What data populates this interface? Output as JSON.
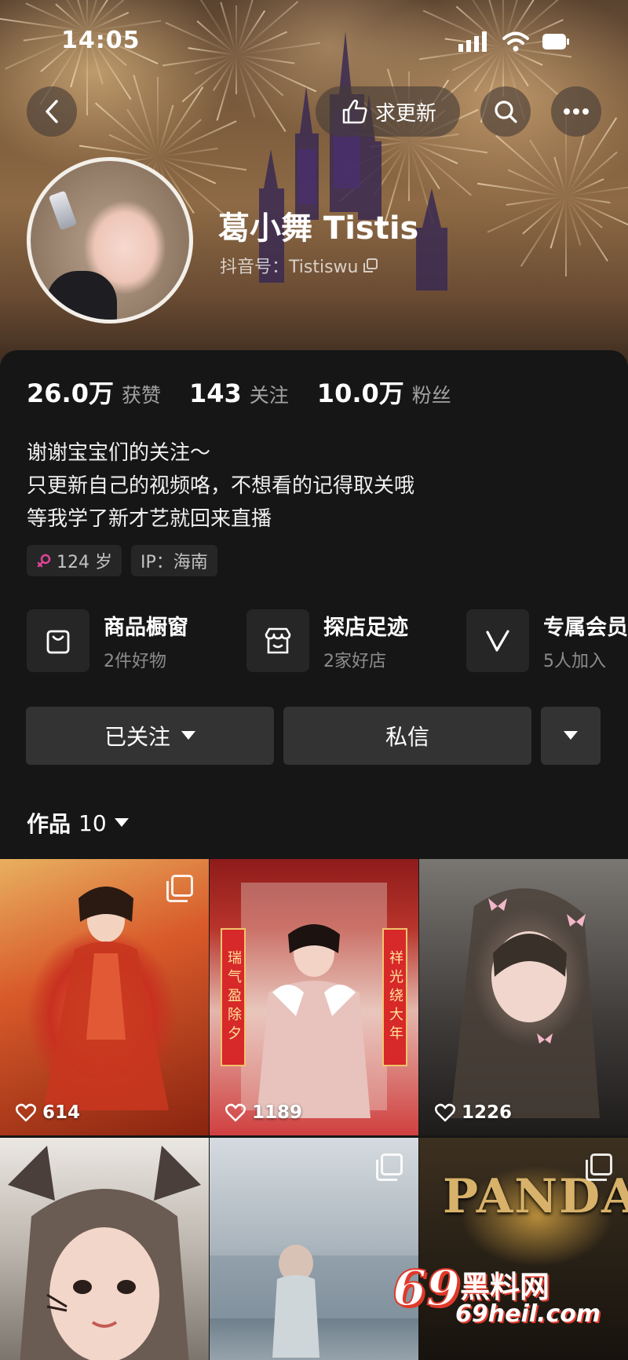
{
  "status_bar": {
    "time": "14:05"
  },
  "nav": {
    "request_update_label": "求更新"
  },
  "profile": {
    "name": "葛小舞 Tistis",
    "douyin_id": "抖音号：Tistiswu"
  },
  "stats": [
    {
      "value": "26.0万",
      "label": "获赞"
    },
    {
      "value": "143",
      "label": "关注"
    },
    {
      "value": "10.0万",
      "label": "粉丝"
    }
  ],
  "bio": [
    "谢谢宝宝们的关注～",
    "只更新自己的视频咯，不想看的记得取关哦",
    "等我学了新才艺就回来直播"
  ],
  "tags": {
    "age": "124 岁",
    "ip": "IP：海南"
  },
  "features": [
    {
      "title": "商品橱窗",
      "sub": "2件好物",
      "icon": "shopping-bag-icon"
    },
    {
      "title": "探店足迹",
      "sub": "2家好店",
      "icon": "store-icon"
    },
    {
      "title": "专属会员",
      "sub": "5人加入",
      "icon": "vip-icon"
    }
  ],
  "actions": {
    "follow_label": "已关注",
    "message_label": "私信"
  },
  "works": {
    "label": "作品",
    "count": "10"
  },
  "videos": [
    {
      "likes": "614"
    },
    {
      "likes": "1189"
    },
    {
      "likes": "1226"
    }
  ],
  "tile_texts": {
    "couplet_left": "瑞气盈除夕",
    "couplet_right": "祥光绕大年",
    "panda_title": "PANDA"
  },
  "watermark": {
    "logo_num": "69",
    "logo_cn": "黑料网",
    "url": "69heil.com"
  },
  "colors": {
    "background": "#161616",
    "button": "#333333",
    "chip": "#262626",
    "watermark_red": "#e0392b"
  }
}
